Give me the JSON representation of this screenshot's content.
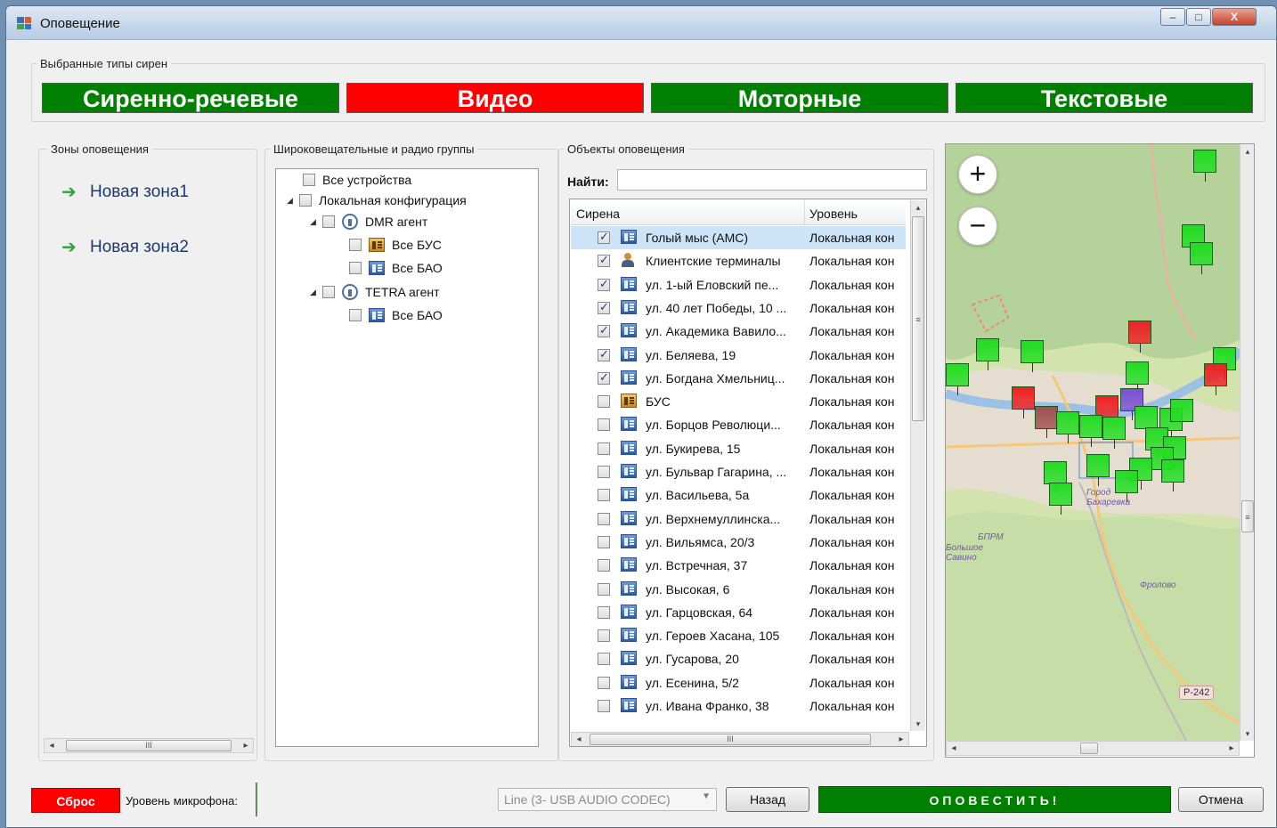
{
  "window": {
    "title": "Оповещение",
    "controls": {
      "minimize": "–",
      "maximize": "□",
      "close": "X"
    }
  },
  "siren_types": {
    "legend": "Выбранные типы сирен",
    "buttons": [
      {
        "label": "Сиренно-речевые",
        "color": "#008000",
        "state": "selected"
      },
      {
        "label": "Видео",
        "color": "#ff0000",
        "state": "not-selected"
      },
      {
        "label": "Моторные",
        "color": "#008000",
        "state": "selected"
      },
      {
        "label": "Текстовые",
        "color": "#008000",
        "state": "selected"
      }
    ]
  },
  "zones": {
    "legend": "Зоны оповещения",
    "items": [
      {
        "label": "Новая зона1",
        "icon": "arrow-right-icon"
      },
      {
        "label": "Новая зона2",
        "icon": "arrow-right-icon"
      }
    ],
    "scroll_thumb": "III"
  },
  "groups": {
    "legend": "Широковещательные и радио группы",
    "tree": [
      {
        "label": "Все устройства",
        "level": 0,
        "checked": false
      },
      {
        "label": "Локальная конфигурация",
        "level": 0,
        "checked": false,
        "expanded": true
      },
      {
        "label": "DMR агент",
        "level": 1,
        "checked": false,
        "expanded": true,
        "icon": "antenna-icon"
      },
      {
        "label": "Все БУС",
        "level": 2,
        "checked": false,
        "icon": "device-orange-icon"
      },
      {
        "label": "Все БАО",
        "level": 2,
        "checked": false,
        "icon": "device-blue-icon"
      },
      {
        "label": "TETRA агент",
        "level": 1,
        "checked": false,
        "expanded": true,
        "icon": "antenna-icon"
      },
      {
        "label": "Все БАО",
        "level": 2,
        "checked": false,
        "icon": "device-blue-icon"
      }
    ]
  },
  "objects": {
    "legend": "Объекты оповещения",
    "search_label": "Найти:",
    "search_value": "",
    "columns": [
      "Сирена",
      "Уровень"
    ],
    "rows": [
      {
        "name": "Голый мыс (АМС)",
        "level": "Локальная кон",
        "checked": true,
        "icon": "device-blue-icon",
        "selected": true
      },
      {
        "name": "Клиентские терминалы",
        "level": "Локальная кон",
        "checked": true,
        "icon": "person-icon"
      },
      {
        "name": "ул. 1-ый Еловский пе...",
        "level": "Локальная кон",
        "checked": true,
        "icon": "device-blue-icon"
      },
      {
        "name": "ул. 40 лет Победы, 10 ...",
        "level": "Локальная кон",
        "checked": true,
        "icon": "device-blue-icon"
      },
      {
        "name": "ул. Академика Вавило...",
        "level": "Локальная кон",
        "checked": true,
        "icon": "device-blue-icon"
      },
      {
        "name": "ул. Беляева, 19",
        "level": "Локальная кон",
        "checked": true,
        "icon": "device-blue-icon"
      },
      {
        "name": "ул. Богдана Хмельниц...",
        "level": "Локальная кон",
        "checked": true,
        "icon": "device-blue-icon"
      },
      {
        "name": "БУС",
        "level": "Локальная кон",
        "checked": false,
        "icon": "device-orange-icon"
      },
      {
        "name": "ул. Борцов Революци...",
        "level": "Локальная кон",
        "checked": false,
        "icon": "device-blue-icon"
      },
      {
        "name": "ул. Букирева, 15",
        "level": "Локальная кон",
        "checked": false,
        "icon": "device-blue-icon"
      },
      {
        "name": "ул. Бульвар Гагарина, ...",
        "level": "Локальная кон",
        "checked": false,
        "icon": "device-blue-icon"
      },
      {
        "name": "ул. Васильева, 5а",
        "level": "Локальная кон",
        "checked": false,
        "icon": "device-blue-icon"
      },
      {
        "name": "ул. Верхнемуллинска...",
        "level": "Локальная кон",
        "checked": false,
        "icon": "device-blue-icon"
      },
      {
        "name": "ул. Вильямса, 20/3",
        "level": "Локальная кон",
        "checked": false,
        "icon": "device-blue-icon"
      },
      {
        "name": "ул. Встречная, 37",
        "level": "Локальная кон",
        "checked": false,
        "icon": "device-blue-icon"
      },
      {
        "name": "ул. Высокая, 6",
        "level": "Локальная кон",
        "checked": false,
        "icon": "device-blue-icon"
      },
      {
        "name": "ул. Гарцовская, 64",
        "level": "Локальная кон",
        "checked": false,
        "icon": "device-blue-icon"
      },
      {
        "name": "ул. Героев Хасана, 105",
        "level": "Локальная кон",
        "checked": false,
        "icon": "device-blue-icon"
      },
      {
        "name": "ул. Гусарова, 20",
        "level": "Локальная кон",
        "checked": false,
        "icon": "device-blue-icon"
      },
      {
        "name": "ул. Есенина, 5/2",
        "level": "Локальная кон",
        "checked": false,
        "icon": "device-blue-icon"
      },
      {
        "name": "ул. Ивана Франко, 38",
        "level": "Локальная кон",
        "checked": false,
        "icon": "device-blue-icon"
      }
    ],
    "scroll_thumb": "III"
  },
  "map": {
    "zoom_in": "+",
    "zoom_out": "−",
    "labels": [
      "БПРМ",
      "Большое Савино",
      "Фролово",
      "Город Бахаревка"
    ],
    "road_label": "P-242",
    "colors": {
      "water": "#a9c8e8",
      "forest": "#b5d29a",
      "urban": "#e3d9cf",
      "marker_green": "#22dd22",
      "marker_red": "#ee2222",
      "marker_purple": "#7a4fd6"
    }
  },
  "bottom": {
    "reset_label": "Сброс",
    "mic_label": "Уровень микрофона:",
    "audio_device": "Line (3- USB AUDIO  CODEC)",
    "back_label": "Назад",
    "notify_label": "ОПОВЕСТИТЬ!",
    "cancel_label": "Отмена"
  }
}
